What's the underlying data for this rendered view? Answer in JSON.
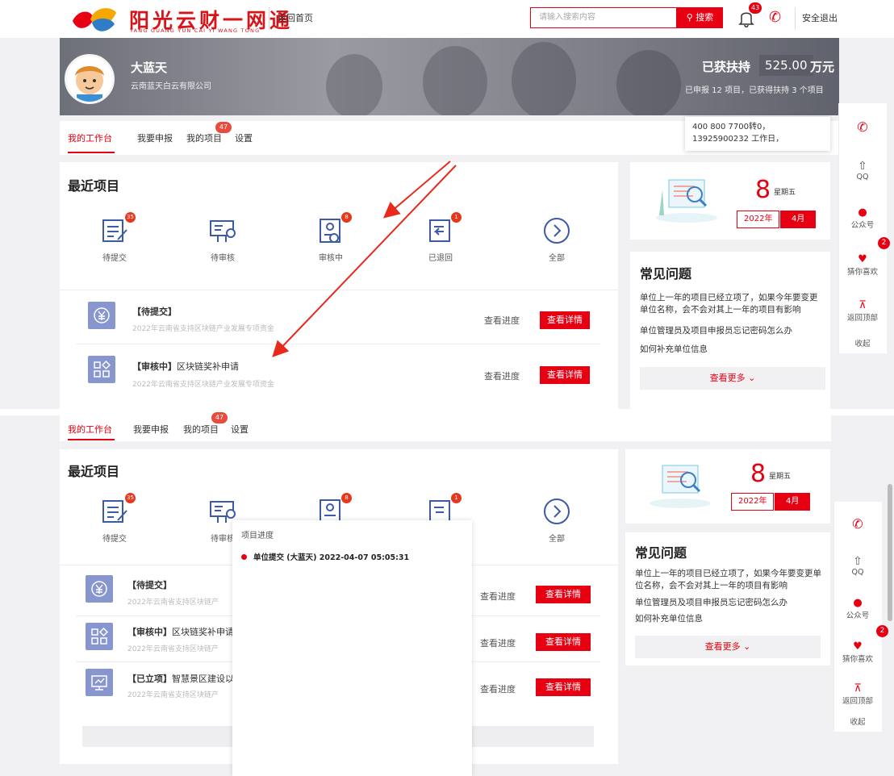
{
  "header": {
    "logo_cn": "阳光云财一网通",
    "logo_en": "YANG GUANG YUN CAI YI WANG TONG",
    "back_home": "返回首页",
    "search_placeholder": "请输入搜索内容",
    "search_button": "搜索",
    "notification_count": "43",
    "logout": "安全退出"
  },
  "profile": {
    "name": "大蓝天",
    "company": "云南蓝天白云有限公司",
    "support_label": "已获扶持",
    "support_value": "525.00",
    "support_unit": "万元",
    "support_sub": "已申报 12 项目，已获得扶持 3 个项目"
  },
  "tabs": [
    {
      "label": "我的工作台",
      "active": true
    },
    {
      "label": "我要申报",
      "active": false
    },
    {
      "label": "我的项目",
      "active": false,
      "badge": "47"
    },
    {
      "label": "设置",
      "active": false
    }
  ],
  "recent": {
    "title": "最近项目",
    "categories": [
      {
        "label": "待提交",
        "badge": "35",
        "icon": "pending-submit-icon"
      },
      {
        "label": "待审核",
        "badge": "",
        "icon": "pending-review-icon"
      },
      {
        "label": "审核中",
        "badge": "8",
        "icon": "reviewing-icon"
      },
      {
        "label": "已退回",
        "badge": "1",
        "icon": "returned-icon"
      },
      {
        "label": "全部",
        "badge": "",
        "icon": "chevron-right-icon"
      }
    ],
    "rows": [
      {
        "status": "【待提交】",
        "name": "",
        "sub": "2022年云南省支持区块链产业发展专项资金",
        "progress": "查看进度",
        "detail": "查看详情",
        "icon": "yuan-icon"
      },
      {
        "status": "【审核中】",
        "name": "区块链奖补申请",
        "sub": "2022年云南省支持区块链产业发展专项资金",
        "progress": "查看进度",
        "detail": "查看详情",
        "icon": "grid-icon"
      },
      {
        "status": "【已立项】",
        "name": "智慧景区建设以",
        "sub": "2022年云南省支持区块链产",
        "progress": "查看进度",
        "detail": "查看详情",
        "icon": "monitor-icon"
      }
    ],
    "row_sub_short": "2022年云南省支持区块链产"
  },
  "calendar": {
    "day": "8",
    "weekday": "星期五",
    "year": "2022年",
    "month": "4月"
  },
  "faq": {
    "title": "常见问题",
    "items": [
      "单位上一年的项目已经立项了，如果今年要变更单位名称，会不会对其上一年的项目有影响",
      "单位管理员及项目申报员忘记密码怎么办",
      "如何补充单位信息"
    ],
    "more": "查看更多"
  },
  "floater": {
    "qq": "QQ",
    "wechat": "公众号",
    "like": "猜你喜欢",
    "like_badge": "2",
    "top": "返回顶部",
    "collapse": "收起"
  },
  "tooltip": {
    "text": "400 800 7700转0，13925900232 工作日，"
  },
  "popup": {
    "title": "项目进度",
    "items": [
      {
        "text": "单位提交 (大蓝天)   2022-04-07 05:05:31"
      }
    ]
  },
  "colors": {
    "accent": "#e60012",
    "icon_blue": "#8896cf",
    "bg": "#f1f1f3"
  }
}
